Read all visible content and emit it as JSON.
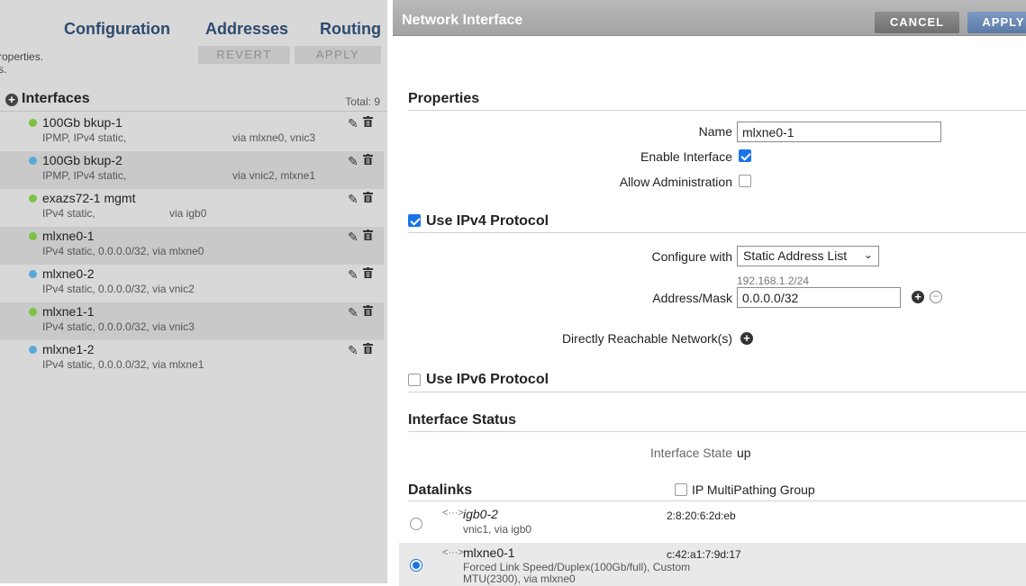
{
  "left": {
    "tabs": [
      "Configuration",
      "Addresses",
      "Routing"
    ],
    "hint": "roperties.",
    "hint2": "s.",
    "revert": "REVERT",
    "apply": "APPLY",
    "section_title": "Interfaces",
    "total": "Total: 9",
    "interfaces": [
      {
        "name": "100Gb bkup-1",
        "desc": "IPMP, IPv4 static,",
        "via": "via mlxne0, vnic3",
        "status_color": "#7dc242"
      },
      {
        "name": "100Gb bkup-2",
        "desc": "IPMP, IPv4 static,",
        "via": "via vnic2, mlxne1",
        "status_color": "#5aa8d6"
      },
      {
        "name": "exazs72-1 mgmt",
        "desc": "IPv4 static,",
        "via": "via igb0",
        "status_color": "#7dc242"
      },
      {
        "name": "mlxne0-1",
        "desc": "IPv4 static, 0.0.0.0/32, via mlxne0",
        "via": "",
        "status_color": "#7dc242"
      },
      {
        "name": "mlxne0-2",
        "desc": "IPv4 static, 0.0.0.0/32, via vnic2",
        "via": "",
        "status_color": "#5aa8d6"
      },
      {
        "name": "mlxne1-1",
        "desc": "IPv4 static, 0.0.0.0/32, via vnic3",
        "via": "",
        "status_color": "#7dc242"
      },
      {
        "name": "mlxne1-2",
        "desc": "IPv4 static, 0.0.0.0/32, via mlxne1",
        "via": "",
        "status_color": "#5aa8d6"
      }
    ]
  },
  "dialog": {
    "title": "Network Interface",
    "cancel": "CANCEL",
    "apply": "APPLY",
    "properties": {
      "title": "Properties",
      "name_label": "Name",
      "name_value": "mlxne0-1",
      "enable_label": "Enable Interface",
      "enable_checked": true,
      "admin_label": "Allow Administration",
      "admin_checked": false
    },
    "ipv4": {
      "title": "Use IPv4 Protocol",
      "checked": true,
      "configure_label": "Configure with",
      "configure_value": "Static Address List",
      "address_hint": "192.168.1.2/24",
      "address_label": "Address/Mask",
      "address_value": "0.0.0.0/32",
      "reachable_label": "Directly Reachable Network(s)"
    },
    "ipv6": {
      "title": "Use IPv6 Protocol",
      "checked": false
    },
    "status": {
      "title": "Interface Status",
      "state_label": "Interface State",
      "state_value": "up"
    },
    "datalinks": {
      "title": "Datalinks",
      "ipmp_label": "IP MultiPathing Group",
      "ipmp_checked": false,
      "arrow": "<···>",
      "items": [
        {
          "name": "igb0-2",
          "desc": "vnic1, via igb0",
          "desc2": "",
          "mac": "2:8:20:6:2d:eb",
          "selected": false
        },
        {
          "name": "mlxne0-1",
          "desc": "Forced Link Speed/Duplex(100Gb/full), Custom",
          "desc2": "MTU(2300), via mlxne0",
          "mac": "c:42:a1:7:9d:17",
          "selected": true
        }
      ]
    }
  }
}
